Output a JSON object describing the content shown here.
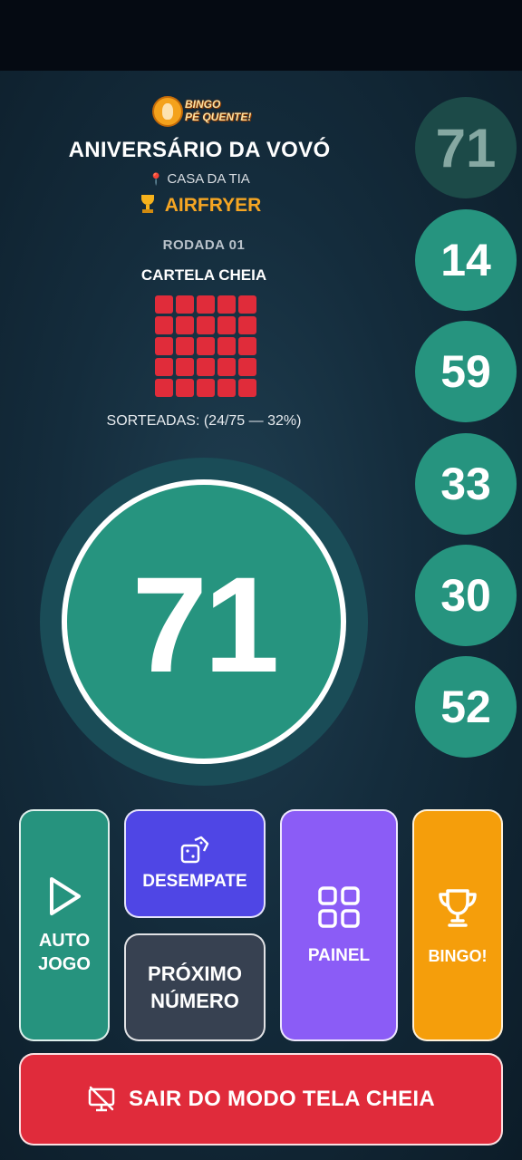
{
  "header": {
    "logo_text_1": "BINGO",
    "logo_text_2": "PÉ QUENTE!",
    "title": "ANIVERSÁRIO DA VOVÓ",
    "location": "CASA DA TIA",
    "prize": "AIRFRYER",
    "round": "RODADA 01",
    "pattern_name": "CARTELA CHEIA",
    "drawn_text": "SORTEADAS: (24/75 — 32%)"
  },
  "current_ball": "71",
  "history": [
    "71",
    "14",
    "59",
    "33",
    "30",
    "52"
  ],
  "buttons": {
    "auto_line1": "AUTO",
    "auto_line2": "JOGO",
    "desempate": "DESEMPATE",
    "proximo_line1": "PRÓXIMO",
    "proximo_line2": "NÚMERO",
    "painel": "PAINEL",
    "bingo": "BINGO!",
    "exit": "SAIR DO MODO TELA CHEIA"
  },
  "colors": {
    "ball": "#26947f",
    "pattern": "#e02c3a",
    "prize": "#f6a623",
    "desempate": "#4f46e5",
    "painel": "#8b5cf6",
    "bingo": "#f59e0b",
    "exit": "#e02b3b"
  },
  "icons": {
    "location": "map-pin-icon",
    "prize": "trophy-icon",
    "auto": "play-icon",
    "desempate": "dice-icon",
    "painel": "grid-icon",
    "bingo": "trophy-icon",
    "exit": "monitor-off-icon"
  }
}
